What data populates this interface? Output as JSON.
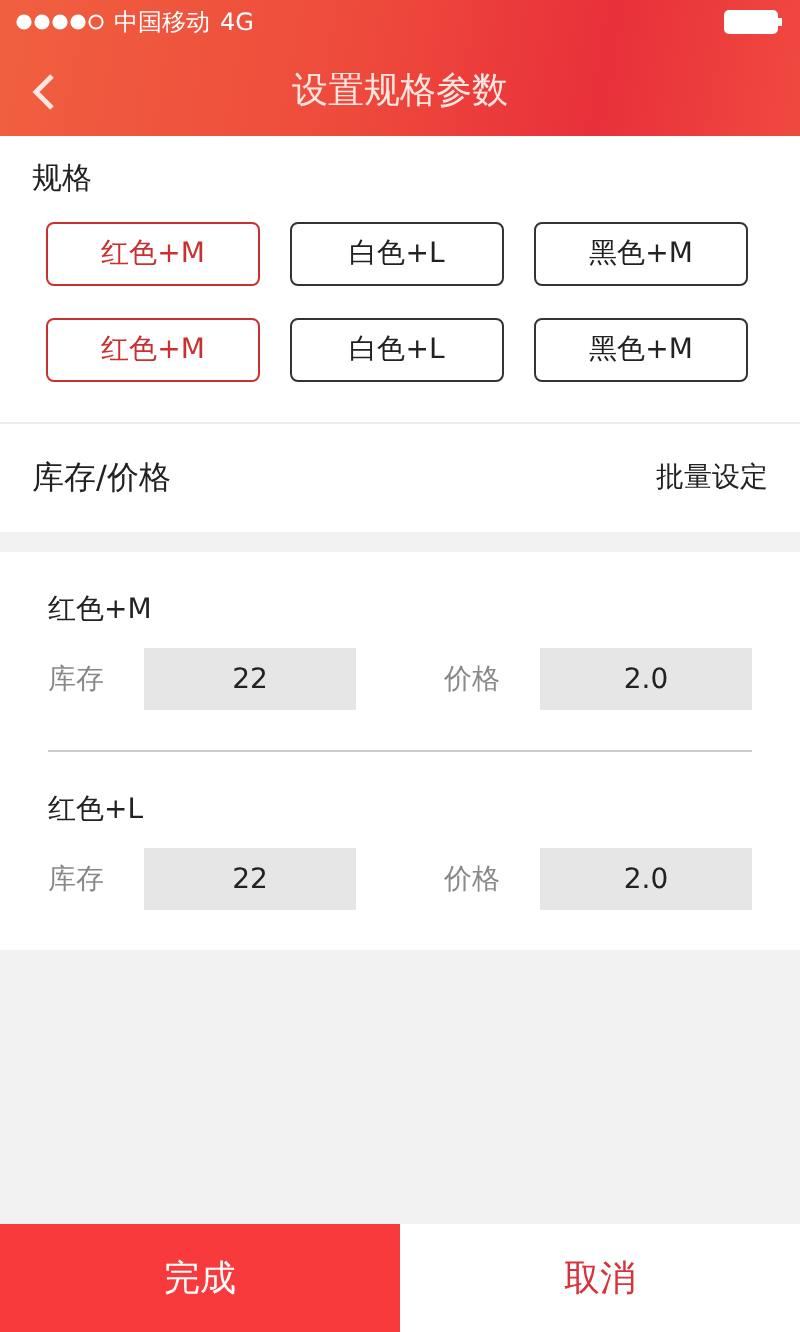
{
  "status_bar": {
    "carrier": "中国移动",
    "network": "4G"
  },
  "nav": {
    "title": "设置规格参数"
  },
  "spec": {
    "label": "规格",
    "options": [
      {
        "label": "红色+M",
        "selected": true
      },
      {
        "label": "白色+L",
        "selected": false
      },
      {
        "label": "黑色+M",
        "selected": false
      },
      {
        "label": "红色+M",
        "selected": true
      },
      {
        "label": "白色+L",
        "selected": false
      },
      {
        "label": "黑色+M",
        "selected": false
      }
    ]
  },
  "stock_price": {
    "label": "库存/价格",
    "action": "批量设定"
  },
  "items": [
    {
      "name": "红色+M",
      "stock_label": "库存",
      "stock": "22",
      "price_label": "价格",
      "price": "2.0"
    },
    {
      "name": "红色+L",
      "stock_label": "库存",
      "stock": "22",
      "price_label": "价格",
      "price": "2.0"
    }
  ],
  "footer": {
    "buttons": [
      {
        "label": "完成",
        "kind": "primary"
      },
      {
        "label": "取消",
        "kind": "secondary"
      }
    ]
  }
}
